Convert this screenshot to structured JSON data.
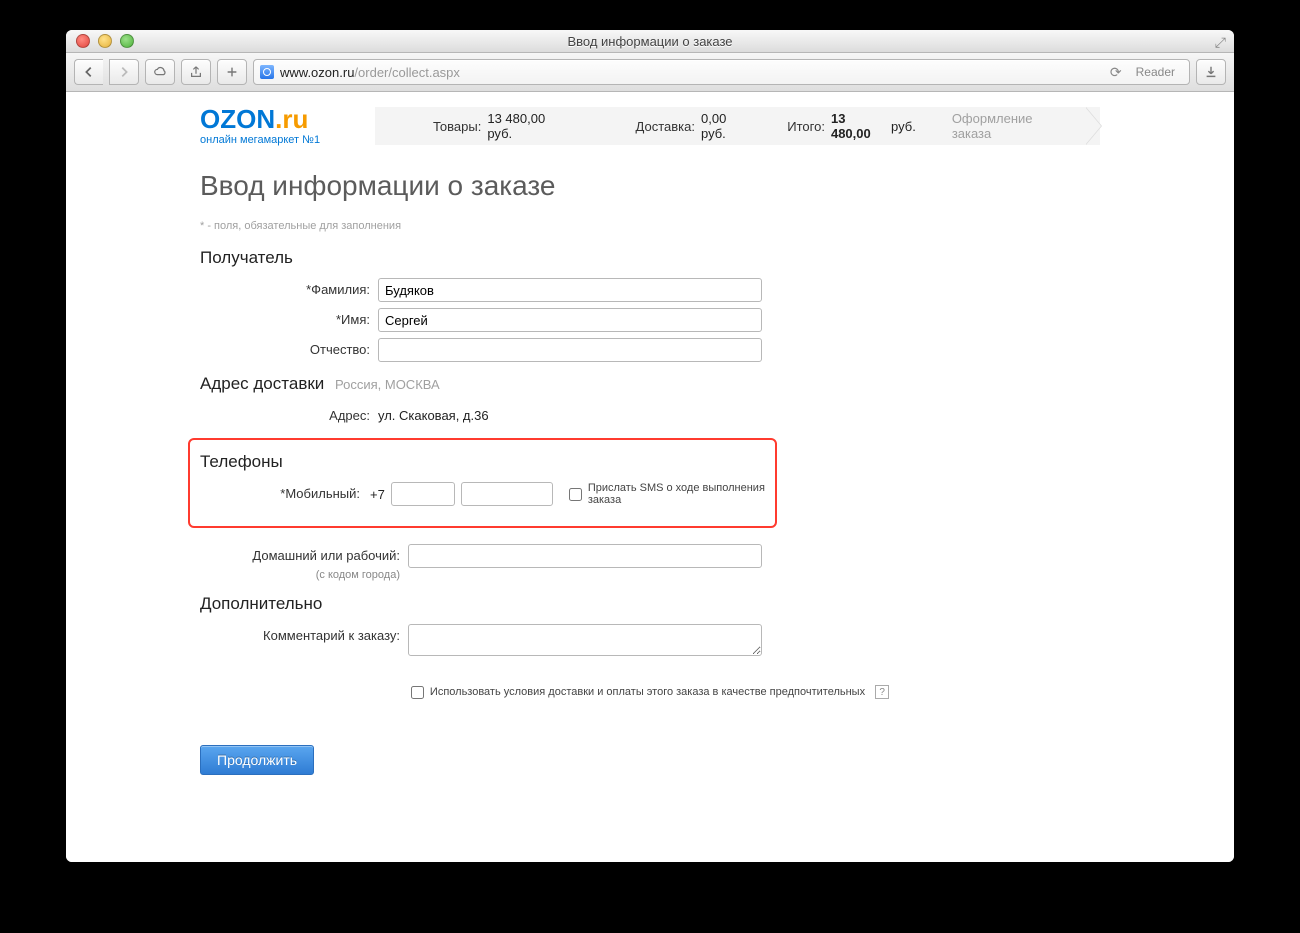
{
  "browser": {
    "window_title": "Ввод информации о заказе",
    "url_host": "www.ozon.ru",
    "url_path": "/order/collect.aspx",
    "reader_label": "Reader"
  },
  "logo": {
    "line1a": "OZON",
    "line1b": ".",
    "line1c": "ru",
    "tagline": "онлайн мегамаркет №1"
  },
  "summary": {
    "items_label": "Товары:",
    "items_value": "13 480,00 руб.",
    "delivery_label": "Доставка:",
    "delivery_value": "0,00 руб.",
    "total_label": "Итого:",
    "total_value": "13 480,00",
    "total_currency": "руб.",
    "checkout": "Оформление заказа"
  },
  "page_title": "Ввод информации о заказе",
  "required_note": "* - поля, обязательные для заполнения",
  "sections": {
    "recipient": "Получатель",
    "address": "Адрес доставки",
    "address_sub": "Россия, МОСКВА",
    "phones": "Телефоны",
    "extra": "Дополнительно"
  },
  "labels": {
    "lastname": "*Фамилия:",
    "firstname": "*Имя:",
    "middlename": "Отчество:",
    "address": "Адрес:",
    "mobile": "*Мобильный:",
    "home": "Домашний или рабочий:",
    "home_sub": "(с кодом города)",
    "comment": "Комментарий к заказу:"
  },
  "values": {
    "lastname": "Будяков",
    "firstname": "Сергей",
    "middlename": "",
    "address": "ул. Скаковая, д.36",
    "mobile_prefix": "+7",
    "mobile_code": "",
    "mobile_number": "",
    "home": "",
    "comment": ""
  },
  "sms_label": "Прислать SMS о ходе выполнения заказа",
  "pref_label": "Использовать условия доставки и оплаты этого заказа в качестве предпочтительных",
  "help_mark": "?",
  "continue": "Продолжить"
}
